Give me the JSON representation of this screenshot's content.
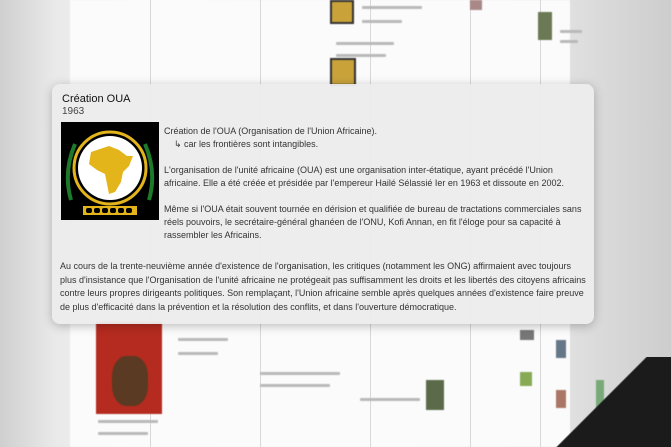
{
  "popup": {
    "title": "Création OUA",
    "year": "1963",
    "intro": "Création de l'OUA (Organisation de l'Union Africaine).",
    "sub": "↳ car les frontières sont intangibles.",
    "p1": "L'organisation de l'unité africaine (OUA) est une organisation inter-étatique, ayant précédé l'Union africaine. Elle a été créée et présidée par l'empereur Hailé Sélassié Ier en 1963 et dissoute en 2002.",
    "p2": "Même si l'OUA était souvent tournée en dérision et qualifiée de bureau de tractations commerciales sans réels pouvoirs, le secrétaire-général ghanéen de l'ONU, Kofi Annan, en fit l'éloge pour sa capacité à rassembler les Africains.",
    "p3": "Au cours de la trente-neuvième année d'existence de l'organisation, les critiques (notamment les ONG) affirmaient avec toujours plus d'insistance que l'Organisation de l'unité africaine ne protégeait pas suffisamment les droits et les libertés des citoyens africains contre leurs propres dirigeants politiques. Son remplaçant, l'Union africaine semble après quelques années d'existence faire preuve de plus d'efficacité dans la prévention et la résolution des conflits, et dans l'ouverture démocratique."
  },
  "colors": {
    "emblem_bg": "#000000",
    "emblem_gold": "#e3b51b",
    "emblem_green": "#1d7a2a"
  },
  "icons": [
    "oau-emblem-icon"
  ]
}
